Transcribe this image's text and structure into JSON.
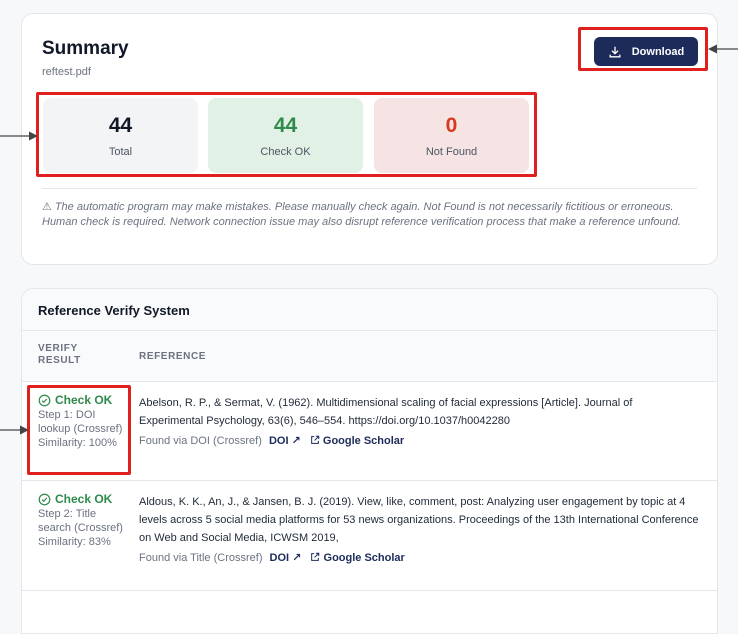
{
  "summary": {
    "title": "Summary",
    "filename": "reftest.pdf",
    "download_label": "Download",
    "stats": {
      "total": {
        "value": "44",
        "label": "Total"
      },
      "ok": {
        "value": "44",
        "label": "Check OK"
      },
      "not_found": {
        "value": "0",
        "label": "Not Found"
      }
    },
    "disclaimer": "⚠ The automatic program may make mistakes. Please manually check again. Not Found is not necessarily fictitious or erroneous. Human check is required. Network connection issue may also disrupt reference verification process that make a reference unfound."
  },
  "references": {
    "title": "Reference Verify System",
    "col_verify": "VERIFY RESULT",
    "col_reference": "REFERENCE",
    "rows": [
      {
        "status": "Check OK",
        "step": "Step 1: DOI lookup (Crossref)",
        "similarity": "Similarity: 100%",
        "text": "Abelson, R. P., & Sermat, V. (1962). Multidimensional scaling of facial expressions [Article]. Journal of Experimental Psychology, 63(6), 546–554. https://doi.org/10.1037/h0042280",
        "found": "Found via DOI (Crossref)",
        "doi_label": "DOI ↗",
        "scholar_label": "Google Scholar"
      },
      {
        "status": "Check OK",
        "step": "Step 2: Title search (Crossref)",
        "similarity": "Similarity: 83%",
        "text": "Aldous, K. K., An, J., & Jansen, B. J. (2019). View, like, comment, post: Analyzing user engagement by topic at 4 levels across 5 social media platforms for 53 news organizations. Proceedings of the 13th International Conference on Web and Social Media, ICWSM 2019,",
        "found": "Found via Title (Crossref)",
        "doi_label": "DOI ↗",
        "scholar_label": "Google Scholar"
      }
    ]
  },
  "colors": {
    "highlight": "#e0201f",
    "accent": "#1c2b5a",
    "ok": "#2f8a4c",
    "not_found": "#d73a1c"
  }
}
